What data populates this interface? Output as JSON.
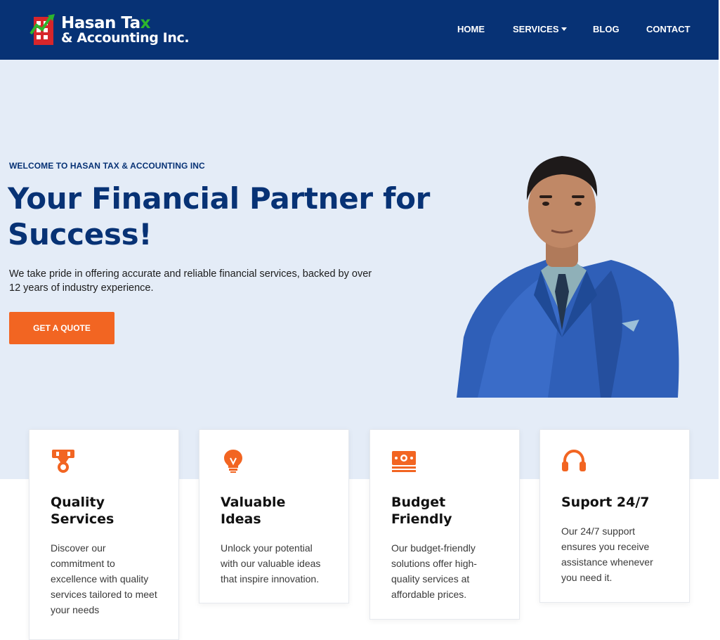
{
  "header": {
    "logo": {
      "line1": "Hasan Ta",
      "line1_accent": "x",
      "line2": "& Accounting Inc."
    },
    "nav": [
      {
        "label": "HOME"
      },
      {
        "label": "SERVICES"
      },
      {
        "label": "BLOG"
      },
      {
        "label": "CONTACT"
      }
    ]
  },
  "hero": {
    "eyebrow": "WELCOME TO HASAN TAX & ACCOUNTING INC",
    "headline": "Your Financial Partner for Success!",
    "lead": "We take pride in offering accurate and reliable financial services, backed by over 12 years of industry experience.",
    "cta_label": "GET A QUOTE"
  },
  "features": [
    {
      "icon": "medal-icon",
      "title": "Quality Services",
      "text": "Discover our commitment to excellence with quality services tailored to meet your needs"
    },
    {
      "icon": "lightbulb-icon",
      "title": "Valuable Ideas",
      "text": "Unlock your potential with our valuable ideas that inspire innovation."
    },
    {
      "icon": "money-bill-icon",
      "title": "Budget Friendly",
      "text": "Our budget-friendly solutions offer high-quality services at affordable prices."
    },
    {
      "icon": "headset-icon",
      "title": "Suport 24/7",
      "text": "Our 24/7 support ensures you receive assistance whenever you need it."
    }
  ],
  "colors": {
    "navy": "#073275",
    "accent_orange": "#f26522",
    "hero_bg": "#e4ecf7",
    "logo_green": "#2db52d",
    "logo_red": "#d7262b"
  }
}
